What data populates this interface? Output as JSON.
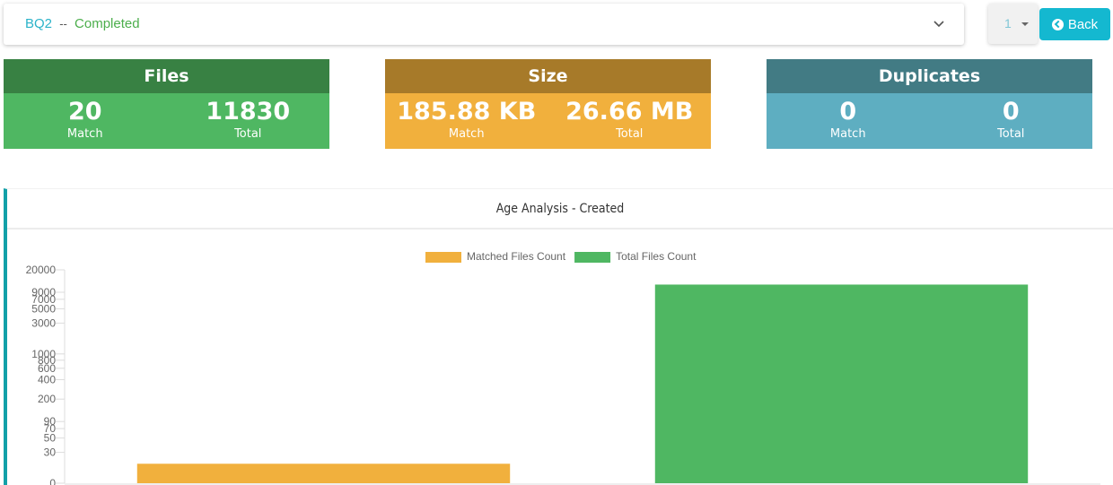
{
  "header": {
    "project": "BQ2",
    "separator": "--",
    "status": "Completed",
    "page_selector_value": "1",
    "back_label": "Back"
  },
  "cards": {
    "files": {
      "title": "Files",
      "match_value": "20",
      "match_label": "Match",
      "total_value": "11830",
      "total_label": "Total"
    },
    "size": {
      "title": "Size",
      "match_value": "185.88 KB",
      "match_label": "Match",
      "total_value": "26.66 MB",
      "total_label": "Total"
    },
    "duplicates": {
      "title": "Duplicates",
      "match_value": "0",
      "match_label": "Match",
      "total_value": "0",
      "total_label": "Total"
    }
  },
  "colors": {
    "accent": "#14b8d0",
    "matched": "#f1b03d",
    "total": "#4fb762"
  },
  "chart_data": {
    "type": "bar",
    "title": "Age Analysis - Created",
    "xlabel": "",
    "ylabel": "",
    "yscale": "log",
    "ylim": [
      0,
      20000
    ],
    "yticks": [
      0,
      30,
      50,
      70,
      90,
      200,
      400,
      600,
      800,
      1000,
      3000,
      5000,
      7000,
      9000,
      20000
    ],
    "legend_position": "top",
    "categories": [
      ""
    ],
    "series": [
      {
        "name": "Matched Files Count",
        "color": "#f1b03d",
        "values": [
          20
        ]
      },
      {
        "name": "Total Files Count",
        "color": "#4fb762",
        "values": [
          11830
        ]
      }
    ]
  }
}
